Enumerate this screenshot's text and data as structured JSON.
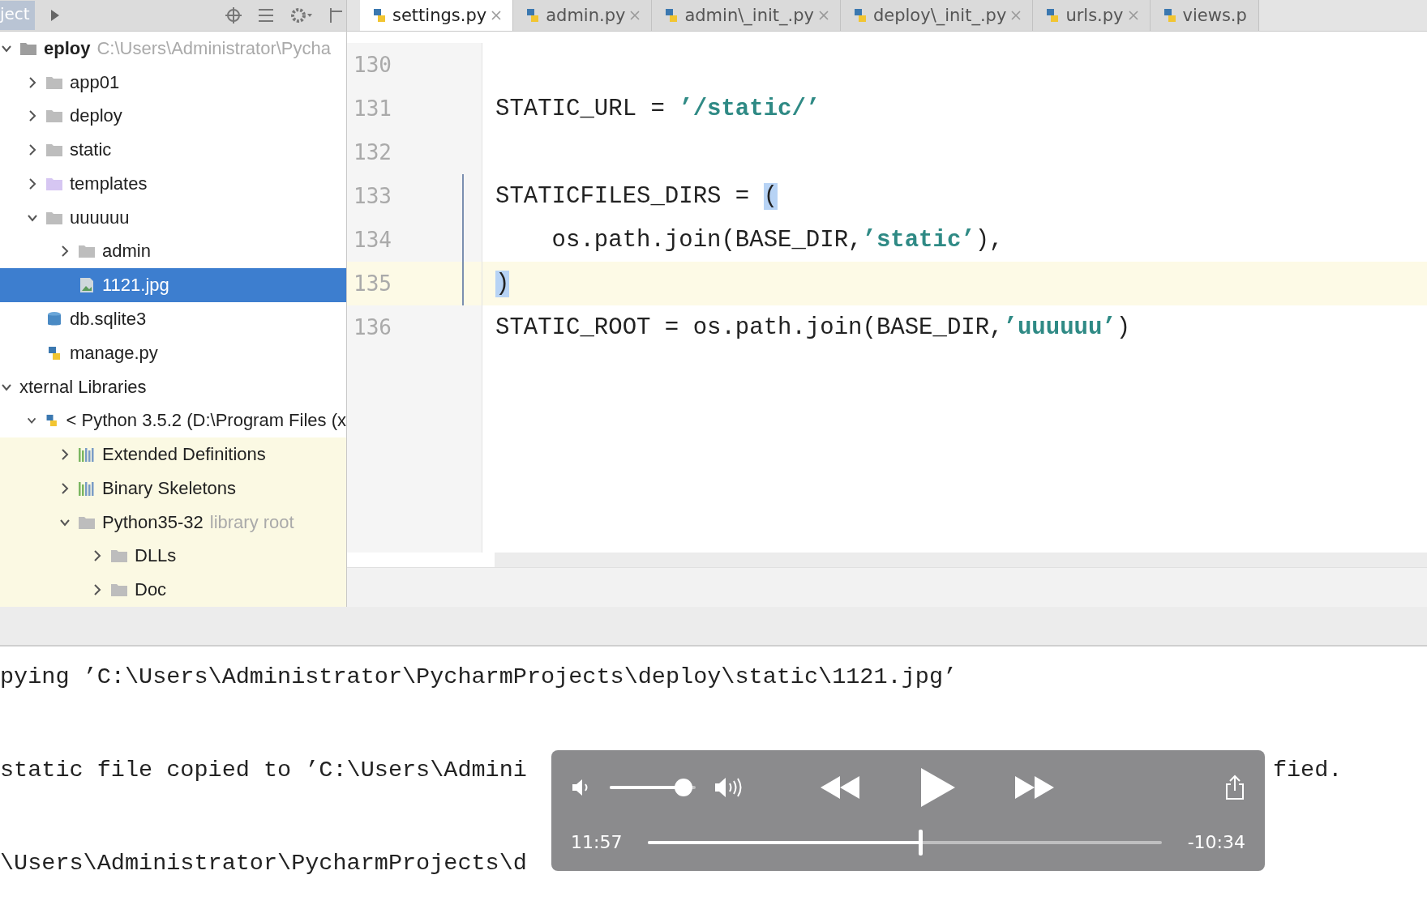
{
  "project_panel": {
    "title": "ject"
  },
  "tabs": [
    {
      "label": "settings.py",
      "selected": true
    },
    {
      "label": "admin.py",
      "selected": false
    },
    {
      "label": "admin\\_init_.py",
      "selected": false
    },
    {
      "label": "deploy\\_init_.py",
      "selected": false
    },
    {
      "label": "urls.py",
      "selected": false
    },
    {
      "label": "views.p",
      "selected": false
    }
  ],
  "tree": [
    {
      "kind": "project",
      "label": "eploy",
      "hint": "C:\\Users\\Administrator\\Pycha",
      "expanded": true,
      "selected": false,
      "children": [
        {
          "kind": "folder",
          "label": "app01",
          "expanded": false,
          "selected": false
        },
        {
          "kind": "folder",
          "label": "deploy",
          "expanded": false,
          "selected": false
        },
        {
          "kind": "folder",
          "label": "static",
          "expanded": false,
          "selected": false
        },
        {
          "kind": "templates",
          "label": "templates",
          "expanded": false,
          "selected": false
        },
        {
          "kind": "folder",
          "label": "uuuuuu",
          "expanded": true,
          "selected": false,
          "children": [
            {
              "kind": "folder",
              "label": "admin",
              "expanded": false,
              "selected": false
            },
            {
              "kind": "image",
              "label": "1121.jpg",
              "selected": true
            }
          ]
        },
        {
          "kind": "database",
          "label": "db.sqlite3",
          "selected": false
        },
        {
          "kind": "python",
          "label": "manage.py",
          "selected": false
        }
      ]
    },
    {
      "kind": "libraries",
      "label": "xternal Libraries",
      "expanded": true,
      "selected": false,
      "children": [
        {
          "kind": "sdk",
          "label": "< Python 3.5.2 (D:\\Program Files (x",
          "expanded": true,
          "selected": false,
          "children": [
            {
              "kind": "library",
              "label": "Extended Definitions",
              "expanded": false,
              "selected": false
            },
            {
              "kind": "library",
              "label": "Binary Skeletons",
              "expanded": false,
              "selected": false
            },
            {
              "kind": "folder",
              "label": "Python35-32",
              "hint": "library root",
              "expanded": true,
              "selected": false,
              "children": [
                {
                  "kind": "folder",
                  "label": "DLLs",
                  "expanded": false,
                  "selected": false
                },
                {
                  "kind": "folder",
                  "label": "Doc",
                  "expanded": false,
                  "selected": false
                }
              ]
            }
          ]
        }
      ]
    }
  ],
  "code_lines": [
    {
      "number": "130",
      "current": false,
      "fold": false
    },
    {
      "number": "131",
      "current": false,
      "fold": false,
      "tokens": [
        {
          "kind": "plain",
          "text": "STATIC_URL = "
        },
        {
          "kind": "string",
          "text": "’/static/’"
        }
      ]
    },
    {
      "number": "132",
      "current": false,
      "fold": false
    },
    {
      "number": "133",
      "current": false,
      "fold": true,
      "tokens": [
        {
          "kind": "plain",
          "text": "STATICFILES_DIRS = "
        },
        {
          "kind": "match",
          "text": "("
        }
      ]
    },
    {
      "number": "134",
      "current": false,
      "fold": true,
      "tokens": [
        {
          "kind": "plain",
          "text": "    os.path.join(BASE_DIR,"
        },
        {
          "kind": "string",
          "text": "’static’"
        },
        {
          "kind": "plain",
          "text": "),"
        }
      ]
    },
    {
      "number": "135",
      "current": true,
      "fold": true,
      "tokens": [
        {
          "kind": "match",
          "text": ")"
        }
      ]
    },
    {
      "number": "136",
      "current": false,
      "fold": false,
      "tokens": [
        {
          "kind": "plain",
          "text": "STATIC_ROOT = os.path.join(BASE_DIR,"
        },
        {
          "kind": "string",
          "text": "’uuuuuu’"
        },
        {
          "kind": "plain",
          "text": ")"
        }
      ]
    }
  ],
  "console": [
    {
      "parts": [
        "pying ’C:\\Users\\Administrator\\PycharmProjects\\deploy\\static\\1121.jpg’"
      ]
    },
    {
      "parts": [
        "static file copied to ’C:\\Users\\Admini",
        "fied."
      ]
    },
    {
      "parts": [
        "\\Users\\Administrator\\PycharmProjects\\d"
      ]
    }
  ],
  "player": {
    "volume": {
      "level": 0.86
    },
    "elapsed": "11:57",
    "remaining": "-10:34",
    "progress": {
      "level": 0.53
    }
  }
}
